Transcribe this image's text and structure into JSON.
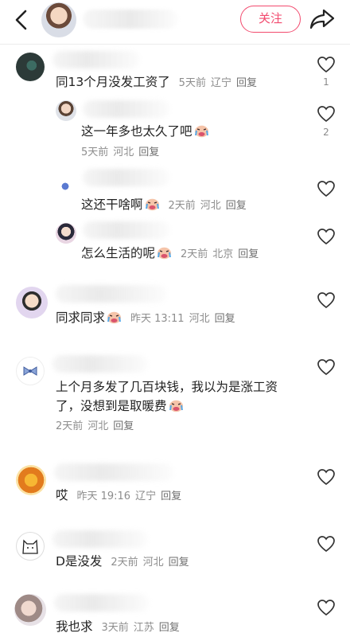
{
  "header": {
    "back_icon": "chevron-left-icon",
    "share_icon": "share-arrow-icon",
    "follow_label": "关注",
    "accent_color": "#f24a6e"
  },
  "comments": [
    {
      "text": "同13个月没发工资了",
      "time": "5天前",
      "location": "辽宁",
      "reply": "回复",
      "likes": "1"
    },
    {
      "text": "这一年多也太久了吧",
      "emoji": "crying-emoji",
      "time": "5天前",
      "location": "河北",
      "reply": "回复",
      "likes": "2"
    },
    {
      "text": "这还干啥啊",
      "emoji": "crying-emoji",
      "time": "2天前",
      "location": "河北",
      "reply": "回复"
    },
    {
      "text": "怎么生活的呢",
      "emoji": "crying-emoji",
      "time": "2天前",
      "location": "北京",
      "reply": "回复"
    },
    {
      "text": "同求同求",
      "emoji": "crying-emoji",
      "time": "昨天 13:11",
      "location": "河北",
      "reply": "回复"
    },
    {
      "text": "上个月多发了几百块钱，我以为是涨工资了，没想到是取暖费",
      "emoji": "crying-emoji",
      "time": "2天前",
      "location": "河北",
      "reply": "回复"
    },
    {
      "text": "哎",
      "time": "昨天 19:16",
      "location": "辽宁",
      "reply": "回复"
    },
    {
      "text": "D是没发",
      "time": "2天前",
      "location": "河北",
      "reply": "回复"
    },
    {
      "text": "我也求",
      "time": "3天前",
      "location": "江苏",
      "reply": "回复"
    }
  ]
}
